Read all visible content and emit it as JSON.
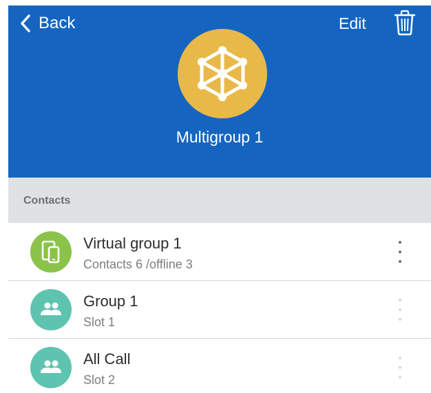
{
  "header": {
    "back_label": "Back",
    "edit_label": "Edit",
    "title": "Multigroup 1",
    "avatar_icon": "network-icon",
    "background_color": "#1565c0",
    "avatar_color": "#e8b949"
  },
  "section": {
    "label": "Contacts"
  },
  "contacts": [
    {
      "title": "Virtual group 1",
      "subtitle": "Contacts 6 /offline 3",
      "icon": "devices-icon",
      "color": "#8bc34a"
    },
    {
      "title": "Group 1",
      "subtitle": "Slot 1",
      "icon": "group-icon",
      "color": "#5ec4b0"
    },
    {
      "title": "All Call",
      "subtitle": "Slot 2",
      "icon": "group-icon",
      "color": "#5ec4b0"
    }
  ]
}
